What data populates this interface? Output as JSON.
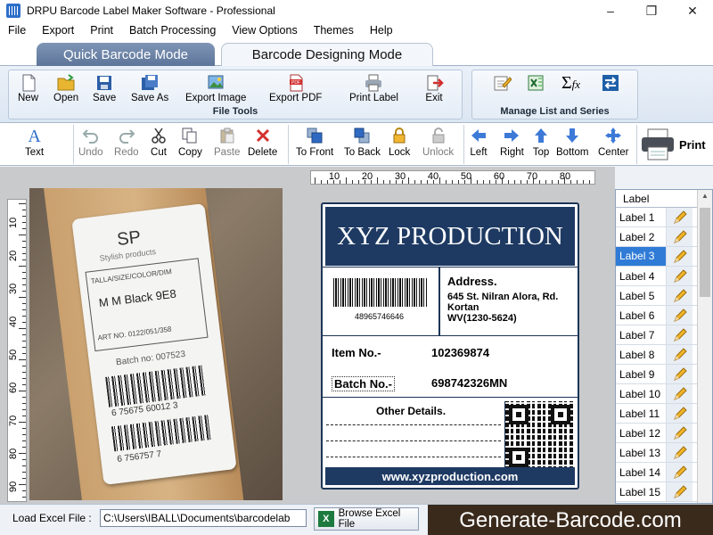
{
  "window": {
    "title": "DRPU Barcode Label Maker Software - Professional"
  },
  "menu": [
    "File",
    "Export",
    "Print",
    "Batch Processing",
    "View Options",
    "Themes",
    "Help"
  ],
  "modes": {
    "quick": "Quick Barcode Mode",
    "design": "Barcode Designing Mode"
  },
  "ribbon": {
    "file_tools": {
      "caption": "File Tools",
      "buttons": [
        "New",
        "Open",
        "Save",
        "Save As",
        "Export Image",
        "Export PDF",
        "Print Label",
        "Exit"
      ]
    },
    "manage": {
      "caption": "Manage List and Series"
    }
  },
  "toolbar": {
    "text": "Text",
    "undo": "Undo",
    "redo": "Redo",
    "cut": "Cut",
    "copy": "Copy",
    "paste": "Paste",
    "delete": "Delete",
    "to_front": "To Front",
    "to_back": "To Back",
    "lock": "Lock",
    "unlock": "Unlock",
    "left": "Left",
    "right": "Right",
    "top": "Top",
    "bottom": "Bottom",
    "center": "Center",
    "print": "Print"
  },
  "ruler": {
    "h": [
      "10",
      "20",
      "30",
      "40",
      "50",
      "60",
      "70",
      "80"
    ],
    "v": [
      "10",
      "20",
      "30",
      "40",
      "50",
      "60",
      "70",
      "80",
      "90"
    ]
  },
  "photo": {
    "brand": "SP",
    "tagline": "Stylish products",
    "size_hdr": "TALLA/SIZE/COLOR/DIM",
    "size_val": "M  M Black  9E8",
    "art": "ART NO. 0122/051/358",
    "batch": "Batch no: 007523",
    "bc1": "6 75675 60012 3",
    "bc2": "6 756757 7"
  },
  "label": {
    "header": "XYZ PRODUCTION",
    "barcode_number": "48965746646",
    "address_title": "Address.",
    "address_line1": "645 St. Nilran Alora, Rd. Kortan",
    "address_line2": "WV(1230-5624)",
    "item_key": "Item No.-",
    "item_val": "102369874",
    "batch_key": "Batch No.-",
    "batch_val": "698742326MN",
    "other": "Other Details.",
    "footer": "www.xyzproduction.com"
  },
  "label_list": {
    "header": "Label",
    "items": [
      "Label 1",
      "Label 2",
      "Label 3",
      "Label 4",
      "Label 5",
      "Label 6",
      "Label 7",
      "Label 8",
      "Label 9",
      "Label 10",
      "Label 11",
      "Label 12",
      "Label 13",
      "Label 14",
      "Label 15"
    ],
    "selected": "Label 3"
  },
  "bottom": {
    "load_label": "Load Excel File :",
    "path": "C:\\Users\\IBALL\\Documents\\barcodelab",
    "browse": "Browse Excel File",
    "watermark": "Generate-Barcode.com"
  },
  "colors": {
    "accent": "#2f7bd6",
    "label_navy": "#1e3a63"
  }
}
